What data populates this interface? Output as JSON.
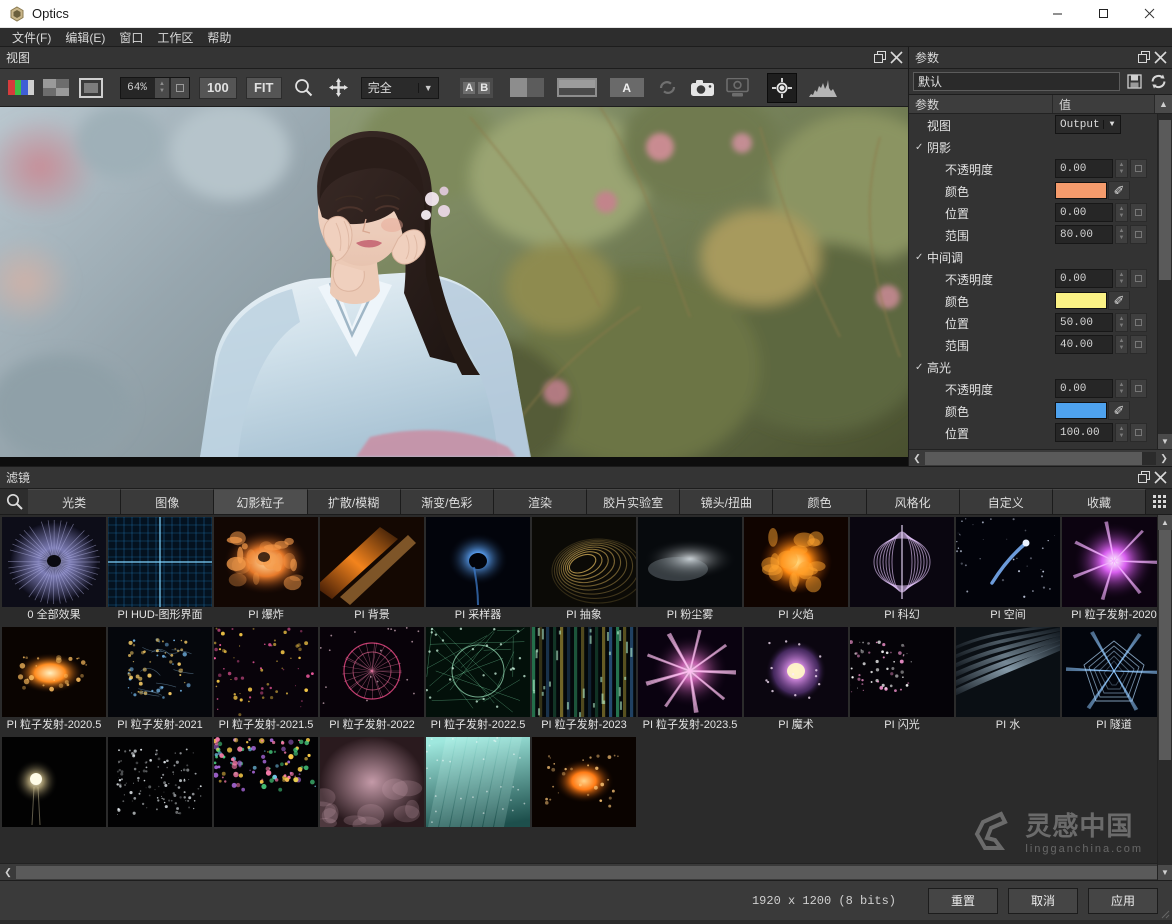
{
  "window": {
    "title": "Optics",
    "app_icon": "hexagon-icon",
    "controls": {
      "minimize": "—",
      "maximize": "☐",
      "close": "✕"
    }
  },
  "menubar": {
    "items": [
      {
        "label": "文件(F)",
        "name": "menu-file"
      },
      {
        "label": "编辑(E)",
        "name": "menu-edit"
      },
      {
        "label": "窗口",
        "name": "menu-window"
      },
      {
        "label": "工作区",
        "name": "menu-workspace"
      },
      {
        "label": "帮助",
        "name": "menu-help"
      }
    ]
  },
  "viewer_panel": {
    "caption": "视图",
    "toolbar": {
      "zoom_value": "64%",
      "btn_100": "100",
      "btn_fit": "FIT",
      "fit_mode": "完全",
      "ab_a": "A",
      "ab_b": "B",
      "a_label": "A"
    }
  },
  "params_panel": {
    "caption": "参数",
    "preset_value": "默认",
    "columns": {
      "name": "参数",
      "value": "值"
    },
    "rows": [
      {
        "level": "grp",
        "label": "视图",
        "type": "combo",
        "value": "Output",
        "checked": false,
        "name": "param-view"
      },
      {
        "level": "grp",
        "label": "阴影",
        "type": "none",
        "value": "",
        "checked": true,
        "name": "param-group-shadow"
      },
      {
        "level": "sub",
        "label": "不透明度",
        "type": "number",
        "value": "0.00",
        "name": "param-shadow-opacity"
      },
      {
        "level": "sub",
        "label": "颜色",
        "type": "color",
        "value": "#f59b6c",
        "name": "param-shadow-color"
      },
      {
        "level": "sub",
        "label": "位置",
        "type": "number",
        "value": "0.00",
        "name": "param-shadow-position"
      },
      {
        "level": "sub",
        "label": "范围",
        "type": "number",
        "value": "80.00",
        "name": "param-shadow-range"
      },
      {
        "level": "grp",
        "label": "中间调",
        "type": "none",
        "value": "",
        "checked": true,
        "name": "param-group-midtone"
      },
      {
        "level": "sub",
        "label": "不透明度",
        "type": "number",
        "value": "0.00",
        "name": "param-midtone-opacity"
      },
      {
        "level": "sub",
        "label": "颜色",
        "type": "color",
        "value": "#fbf285",
        "name": "param-midtone-color"
      },
      {
        "level": "sub",
        "label": "位置",
        "type": "number",
        "value": "50.00",
        "name": "param-midtone-position"
      },
      {
        "level": "sub",
        "label": "范围",
        "type": "number",
        "value": "40.00",
        "name": "param-midtone-range"
      },
      {
        "level": "grp",
        "label": "高光",
        "type": "none",
        "value": "",
        "checked": true,
        "name": "param-group-highlight"
      },
      {
        "level": "sub",
        "label": "不透明度",
        "type": "number",
        "value": "0.00",
        "name": "param-highlight-opacity"
      },
      {
        "level": "sub",
        "label": "颜色",
        "type": "color",
        "value": "#4ea2ee",
        "name": "param-highlight-color"
      },
      {
        "level": "sub",
        "label": "位置",
        "type": "number",
        "value": "100.00",
        "name": "param-highlight-position"
      }
    ]
  },
  "filters_panel": {
    "caption": "滤镜",
    "search_icon": "search-icon",
    "tabs": [
      {
        "label": "光类",
        "active": false
      },
      {
        "label": "图像",
        "active": false
      },
      {
        "label": "幻影粒子",
        "active": true
      },
      {
        "label": "扩散/模糊",
        "active": false
      },
      {
        "label": "渐变/色彩",
        "active": false
      },
      {
        "label": "渲染",
        "active": false
      },
      {
        "label": "胶片实验室",
        "active": false
      },
      {
        "label": "镜头/扭曲",
        "active": false
      },
      {
        "label": "颜色",
        "active": false
      },
      {
        "label": "风格化",
        "active": false
      },
      {
        "label": "自定义",
        "active": false
      },
      {
        "label": "收藏",
        "active": false
      }
    ],
    "items": [
      {
        "label": "0 全部效果",
        "thumb": "burst-violet"
      },
      {
        "label": "PI HUD-图形界面",
        "thumb": "hud-grid"
      },
      {
        "label": "PI 爆炸",
        "thumb": "explosion"
      },
      {
        "label": "PI 背景",
        "thumb": "background-streak"
      },
      {
        "label": "PI 采样器",
        "thumb": "sampler-blackhole"
      },
      {
        "label": "PI 抽象",
        "thumb": "abstract-swirl"
      },
      {
        "label": "PI 粉尘雾",
        "thumb": "dust-fog"
      },
      {
        "label": "PI 火焰",
        "thumb": "flame"
      },
      {
        "label": "PI 科幻",
        "thumb": "scifi-rings"
      },
      {
        "label": "PI 空间",
        "thumb": "space-streak"
      },
      {
        "label": "PI 粒子发射-2020",
        "thumb": "emit-2020"
      },
      {
        "label": "PI 粒子发射-2020.5",
        "thumb": "emit-2020-5"
      },
      {
        "label": "PI 粒子发射-2021",
        "thumb": "emit-2021"
      },
      {
        "label": "PI 粒子发射-2021.5",
        "thumb": "emit-2021-5"
      },
      {
        "label": "PI 粒子发射-2022",
        "thumb": "emit-2022"
      },
      {
        "label": "PI 粒子发射-2022.5",
        "thumb": "emit-2022-5"
      },
      {
        "label": "PI 粒子发射-2023",
        "thumb": "emit-2023"
      },
      {
        "label": "PI 粒子发射-2023.5",
        "thumb": "emit-2023-5"
      },
      {
        "label": "PI 魔术",
        "thumb": "magic-orb"
      },
      {
        "label": "PI 闪光",
        "thumb": "flash-sparks"
      },
      {
        "label": "PI 水",
        "thumb": "water"
      },
      {
        "label": "PI 隧道",
        "thumb": "tunnel"
      },
      {
        "label": "",
        "thumb": "glow-point"
      },
      {
        "label": "",
        "thumb": "star-cluster"
      },
      {
        "label": "",
        "thumb": "confetti"
      },
      {
        "label": "",
        "thumb": "rose-haze"
      },
      {
        "label": "",
        "thumb": "teal-rays"
      },
      {
        "label": "",
        "thumb": "ember-burst"
      }
    ]
  },
  "watermark": {
    "main": "灵感中国",
    "sub": "lingganchina.com"
  },
  "bottombar": {
    "dimensions": "1920 x 1200 (8 bits)",
    "reset": "重置",
    "cancel": "取消",
    "apply": "应用"
  }
}
